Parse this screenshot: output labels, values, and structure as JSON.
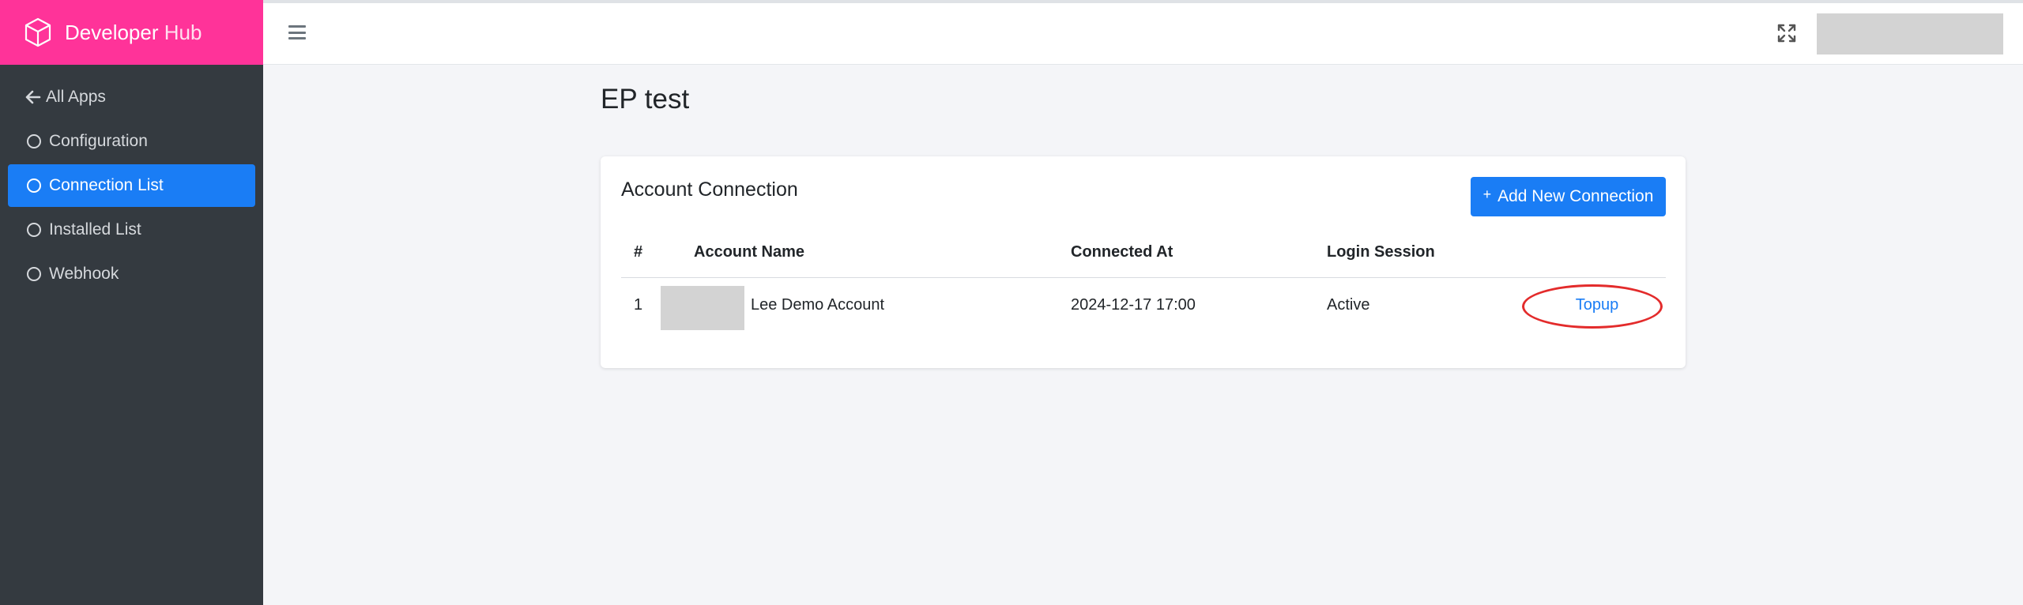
{
  "brand": {
    "name": "Developer",
    "suffix": "Hub",
    "color": "#ff3399"
  },
  "nav": {
    "back_label": "All Apps",
    "items": [
      {
        "label": "Configuration",
        "active": false
      },
      {
        "label": "Connection List",
        "active": true
      },
      {
        "label": "Installed List",
        "active": false
      },
      {
        "label": "Webhook",
        "active": false
      }
    ]
  },
  "page": {
    "title": "EP test"
  },
  "card": {
    "title": "Account Connection",
    "add_button_label": "Add New Connection",
    "columns": [
      "#",
      "Account Name",
      "Connected At",
      "Login Session"
    ],
    "rows": [
      {
        "num": "1",
        "account_name": "Lee Demo Account",
        "connected_at": "2024-12-17 17:00",
        "login_session": "Active",
        "action": "Topup"
      }
    ]
  },
  "colors": {
    "accent": "#1a7df5",
    "sidebar_bg": "#343a40",
    "annotation": "#e32b2b"
  },
  "icons": [
    "cube-icon",
    "arrow-left-icon",
    "circle-icon",
    "hamburger-icon",
    "expand-icon",
    "plus-icon"
  ]
}
